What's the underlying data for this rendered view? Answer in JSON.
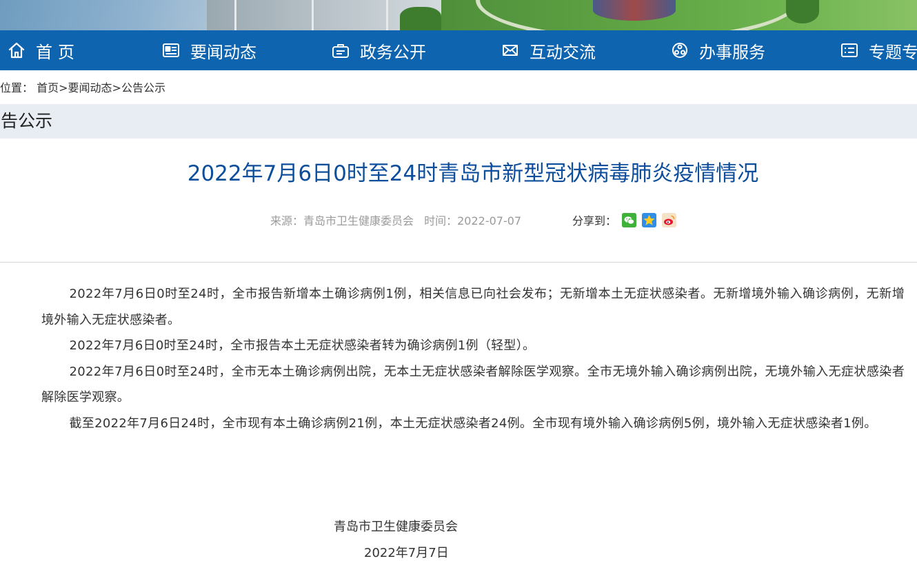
{
  "nav": {
    "items": [
      {
        "label": "首页",
        "icon": "home-icon"
      },
      {
        "label": "要闻动态",
        "icon": "news-icon"
      },
      {
        "label": "政务公开",
        "icon": "briefcase-icon"
      },
      {
        "label": "互动交流",
        "icon": "mail-icon"
      },
      {
        "label": "办事服务",
        "icon": "service-icon"
      },
      {
        "label": "专题专",
        "icon": "list-icon"
      }
    ]
  },
  "breadcrumb": {
    "prefix": "位置：",
    "items": [
      "首页",
      "要闻动态",
      "公告公示"
    ],
    "separator": ">"
  },
  "section": {
    "title": "公告公示"
  },
  "article": {
    "title": "2022年7月6日0时至24时青岛市新型冠状病毒肺炎疫情情况",
    "source": "来源：青岛市卫生健康委员会",
    "time": "时间：2022-07-07",
    "share_label": "分享到：",
    "share_icons": [
      "wechat-icon",
      "qzone-icon",
      "weibo-icon"
    ],
    "paragraphs": [
      "2022年7月6日0时至24时，全市报告新增本土确诊病例1例，相关信息已向社会发布；无新增本土无症状感染者。无新增境外输入确诊病例，无新增境外输入无症状感染者。",
      "2022年7月6日0时至24时，全市报告本土无症状感染者转为确诊病例1例（轻型）。",
      "2022年7月6日0时至24时，全市无本土确诊病例出院，无本土无症状感染者解除医学观察。全市无境外输入确诊病例出院，无境外输入无症状感染者解除医学观察。",
      "截至2022年7月6日24时，全市现有本土确诊病例21例，本土无症状感染者24例。全市现有境外输入确诊病例5例，境外输入无症状感染者1例。"
    ],
    "signature_org": "青岛市卫生健康委员会",
    "signature_date": "2022年7月7日"
  },
  "colors": {
    "nav_bg": "#0e64ae",
    "title_blue": "#0d4e9c",
    "section_bg": "#e8edf3"
  }
}
